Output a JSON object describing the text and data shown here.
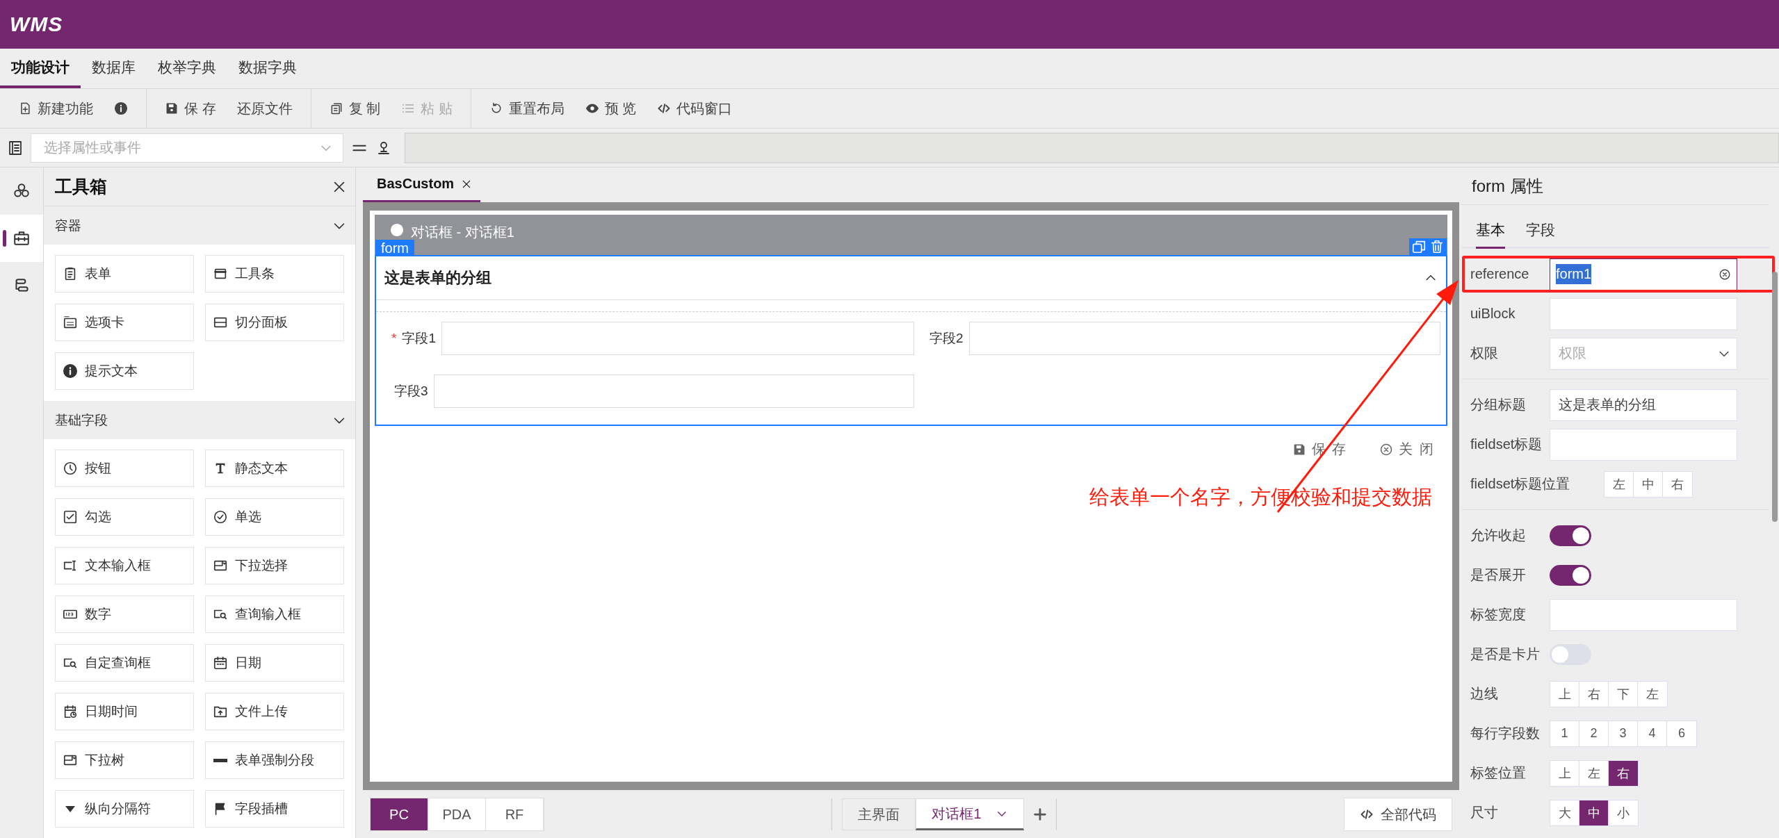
{
  "app": {
    "logo": "WMS"
  },
  "menu_tabs": [
    {
      "label": "功能设计",
      "selected": true
    },
    {
      "label": "数据库",
      "selected": false
    },
    {
      "label": "枚举字典",
      "selected": false
    },
    {
      "label": "数据字典",
      "selected": false
    }
  ],
  "toolbar": [
    [
      {
        "kind": "button",
        "label": "新建功能",
        "disabled": false
      },
      {
        "kind": "icon",
        "disabled": false
      }
    ],
    [
      {
        "kind": "button",
        "label": "保 存",
        "disabled": false
      },
      {
        "kind": "text",
        "label": "还原文件",
        "disabled": false
      }
    ],
    [
      {
        "kind": "button",
        "label": "复 制",
        "disabled": false
      },
      {
        "kind": "button",
        "label": "粘 贴",
        "disabled": true
      }
    ],
    [
      {
        "kind": "button",
        "label": "重置布局",
        "disabled": false
      },
      {
        "kind": "button",
        "label": "预 览",
        "disabled": false
      },
      {
        "kind": "button",
        "label": "代码窗口",
        "disabled": false
      }
    ]
  ],
  "attribute_bar": {
    "placeholder": "选择属性或事件"
  },
  "rail": [
    {
      "selected": false
    },
    {
      "selected": true
    },
    {
      "selected": false
    }
  ],
  "toolbox": {
    "title": "工具箱",
    "sections": [
      {
        "title": "容器",
        "expanded": true,
        "items": [
          "表单",
          "工具条",
          "选项卡",
          "切分面板",
          "提示文本"
        ]
      },
      {
        "title": "基础字段",
        "expanded": true,
        "items": [
          "按钮",
          "静态文本",
          "勾选",
          "单选",
          "文本输入框",
          "下拉选择",
          "数字",
          "查询输入框",
          "自定查询框",
          "日期",
          "日期时间",
          "文件上传",
          "下拉树",
          "表单强制分段",
          "纵向分隔符",
          "字段插槽"
        ]
      }
    ]
  },
  "doc_tabs": [
    {
      "label": "BasCustom",
      "selected": true
    }
  ],
  "dialog": {
    "title": "对话框 - 对话框1",
    "badge": "form",
    "group": {
      "title": "这是表单的分组",
      "expanded": true
    },
    "required_mark": "*",
    "fields": [
      {
        "label": "字段1",
        "required": true
      },
      {
        "label": "字段2",
        "required": false
      },
      {
        "label": "字段3",
        "required": false
      }
    ],
    "buttons": [
      "保 存",
      "关 闭"
    ]
  },
  "annotation": {
    "text": "给表单一个名字，方便校验和提交数据"
  },
  "platform_tabs": [
    {
      "label": "PC",
      "selected": true
    },
    {
      "label": "PDA",
      "selected": false
    },
    {
      "label": "RF",
      "selected": false
    }
  ],
  "page_tabs": [
    {
      "label": "主界面",
      "selected": false
    },
    {
      "label": "对话框1",
      "selected": true
    }
  ],
  "code_button": "全部代码",
  "properties": {
    "title": "form 属性",
    "tabs": [
      {
        "label": "基本",
        "selected": true
      },
      {
        "label": "字段",
        "selected": false
      }
    ],
    "sections": [
      [
        {
          "kind": "input",
          "label": "reference",
          "value": "form1",
          "focused": true,
          "outlined": true
        },
        {
          "kind": "input",
          "label": "uiBlock",
          "focused": false,
          "outlined": false
        },
        {
          "kind": "select",
          "label": "权限",
          "placeholder": "权限"
        }
      ],
      [
        {
          "kind": "input",
          "label": "分组标题",
          "value": "这是表单的分组",
          "focused": false,
          "outlined": false
        },
        {
          "kind": "input",
          "label": "fieldset标题",
          "focused": false,
          "outlined": false
        },
        {
          "kind": "segmented",
          "label": "fieldset标题位置",
          "options": [
            {
              "label": "左",
              "selected": false
            },
            {
              "label": "中",
              "selected": false
            },
            {
              "label": "右",
              "selected": false
            }
          ]
        }
      ],
      [
        {
          "kind": "switch",
          "label": "允许收起",
          "on": true
        },
        {
          "kind": "switch",
          "label": "是否展开",
          "on": true
        },
        {
          "kind": "input",
          "label": "标签宽度",
          "focused": false,
          "outlined": false
        },
        {
          "kind": "switch",
          "label": "是否是卡片",
          "on": false
        },
        {
          "kind": "segmented",
          "label": "边线",
          "options": [
            {
              "label": "上",
              "selected": false
            },
            {
              "label": "右",
              "selected": false
            },
            {
              "label": "下",
              "selected": false
            },
            {
              "label": "左",
              "selected": false
            }
          ]
        },
        {
          "kind": "segmented",
          "label": "每行字段数",
          "options": [
            {
              "label": "1",
              "selected": false
            },
            {
              "label": "2",
              "selected": false
            },
            {
              "label": "3",
              "selected": false
            },
            {
              "label": "4",
              "selected": false
            },
            {
              "label": "6",
              "selected": false
            }
          ]
        },
        {
          "kind": "segmented",
          "label": "标签位置",
          "options": [
            {
              "label": "上",
              "selected": false
            },
            {
              "label": "左",
              "selected": false
            },
            {
              "label": "右",
              "selected": true
            }
          ]
        },
        {
          "kind": "segmented",
          "label": "尺寸",
          "options": [
            {
              "label": "大",
              "selected": false
            },
            {
              "label": "中",
              "selected": true
            },
            {
              "label": "小",
              "selected": false
            }
          ]
        }
      ]
    ]
  }
}
